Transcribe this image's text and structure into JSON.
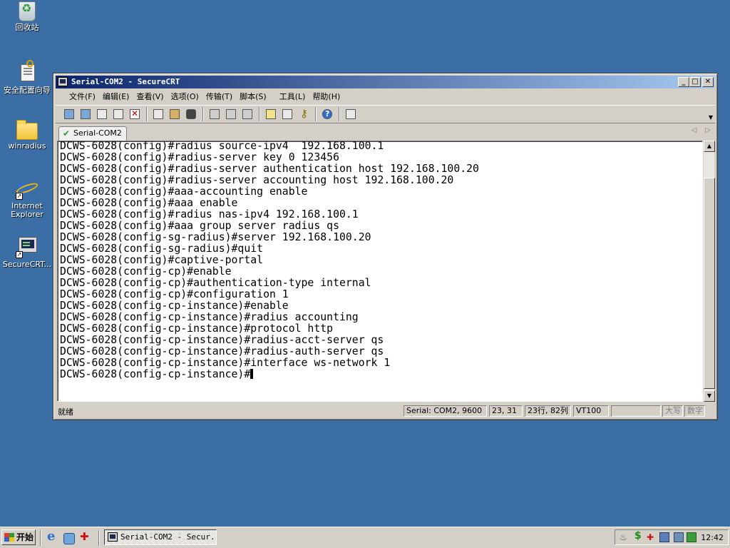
{
  "desktop": {
    "icons": [
      {
        "label": "回收站",
        "icon": "recycle-bin-icon"
      },
      {
        "label": "安全配置向导",
        "icon": "security-wizard-icon"
      },
      {
        "label": "winradius",
        "icon": "folder-icon"
      },
      {
        "label": "Internet Explorer",
        "icon": "internet-explorer-icon"
      },
      {
        "label": "SecureCRT...",
        "icon": "securecrt-icon"
      }
    ]
  },
  "window": {
    "title": "Serial-COM2 - SecureCRT",
    "controls": {
      "minimize": "_",
      "maximize": "□",
      "close": "✕"
    },
    "menu": [
      "文件(F)",
      "编辑(E)",
      "查看(V)",
      "选项(O)",
      "传输(T)",
      "脚本(S)",
      "工具(L)",
      "帮助(H)"
    ],
    "tab": {
      "label": "Serial-COM2",
      "active": true
    },
    "terminal_lines": [
      "DCWS-6028(config)#radius source-ipv4  192.168.100.1",
      "DCWS-6028(config)#radius-server key 0 123456",
      "DCWS-6028(config)#radius-server authentication host 192.168.100.20",
      "DCWS-6028(config)#radius-server accounting host 192.168.100.20",
      "DCWS-6028(config)#aaa-accounting enable",
      "DCWS-6028(config)#aaa enable",
      "DCWS-6028(config)#radius nas-ipv4 192.168.100.1",
      "DCWS-6028(config)#aaa group server radius qs",
      "DCWS-6028(config-sg-radius)#server 192.168.100.20",
      "DCWS-6028(config-sg-radius)#quit",
      "DCWS-6028(config)#captive-portal",
      "DCWS-6028(config-cp)#enable",
      "DCWS-6028(config-cp)#authentication-type internal",
      "DCWS-6028(config-cp)#configuration 1",
      "DCWS-6028(config-cp-instance)#enable",
      "DCWS-6028(config-cp-instance)#radius accounting",
      "DCWS-6028(config-cp-instance)#protocol http",
      "DCWS-6028(config-cp-instance)#radius-acct-server qs",
      "DCWS-6028(config-cp-instance)#radius-auth-server qs",
      "DCWS-6028(config-cp-instance)#interface ws-network 1",
      "DCWS-6028(config-cp-instance)#"
    ],
    "status": {
      "ready": "就绪",
      "connection": "Serial: COM2, 9600",
      "cursor_pos": "23, 31",
      "rows_cols": "23行, 82列",
      "emulation": "VT100",
      "blank": "",
      "caps": "大写",
      "num": "数字"
    }
  },
  "taskbar": {
    "start_label": "开始",
    "task_label": "Serial-COM2 - Secur...",
    "clock": "12:42"
  }
}
